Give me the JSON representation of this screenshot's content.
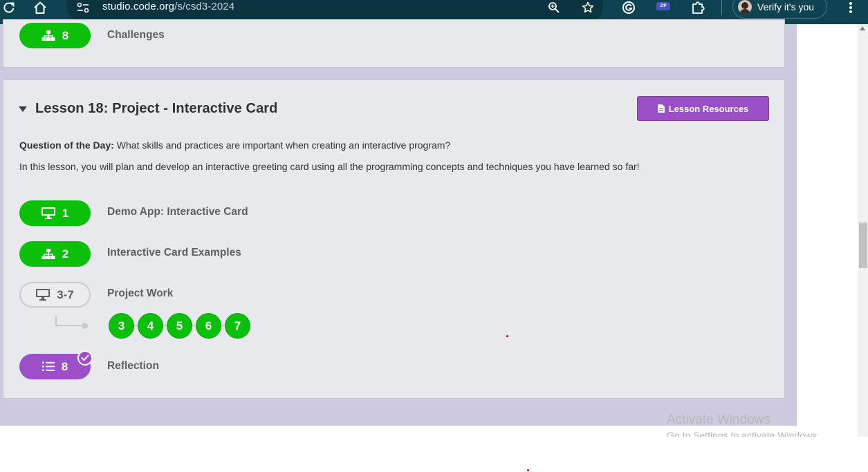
{
  "browser": {
    "url_host": "studio.code.org",
    "url_path": "/s/csd3-2024",
    "profile_label": "Verify it's you",
    "zip_label": "ZIP",
    "icons": [
      "reload-icon",
      "home-icon",
      "site-info-icon",
      "zoom-icon",
      "bookmark-star-icon",
      "grammarly-icon",
      "zip-extension-icon",
      "extensions-icon",
      "avatar",
      "menu-icon"
    ]
  },
  "previous_lesson": {
    "level": {
      "number": "8",
      "icon": "sitemap-icon",
      "name": "Challenges"
    }
  },
  "lesson": {
    "title": "Lesson 18: Project - Interactive Card",
    "resources_label": "Lesson Resources",
    "question_prefix": "Question of the Day:",
    "question_text": "What skills and practices are important when creating an interactive program?",
    "overview": "In this lesson, you will plan and develop an interactive greeting card using all the programming concepts and techniques you have learned so far!",
    "levels": [
      {
        "number": "1",
        "icon": "monitor-icon",
        "name": "Demo App: Interactive Card",
        "status": "completed"
      },
      {
        "number": "2",
        "icon": "sitemap-icon",
        "name": "Interactive Card Examples",
        "status": "completed"
      },
      {
        "number": "3-7",
        "icon": "monitor-icon",
        "name": "Project Work",
        "status": "not-started",
        "sublevels": [
          "3",
          "4",
          "5",
          "6",
          "7"
        ]
      },
      {
        "number": "8",
        "icon": "list-icon",
        "name": "Reflection",
        "status": "submitted"
      }
    ]
  },
  "os_watermark": {
    "line1": "Activate Windows",
    "line2": "Go to Settings to activate Windows."
  },
  "colors": {
    "toolbar": "#0e4452",
    "page_background": "#cfc9df",
    "card_background": "#e8e9ec",
    "completed_green": "#0bbf0b",
    "accent_purple": "#9c4fc6"
  }
}
